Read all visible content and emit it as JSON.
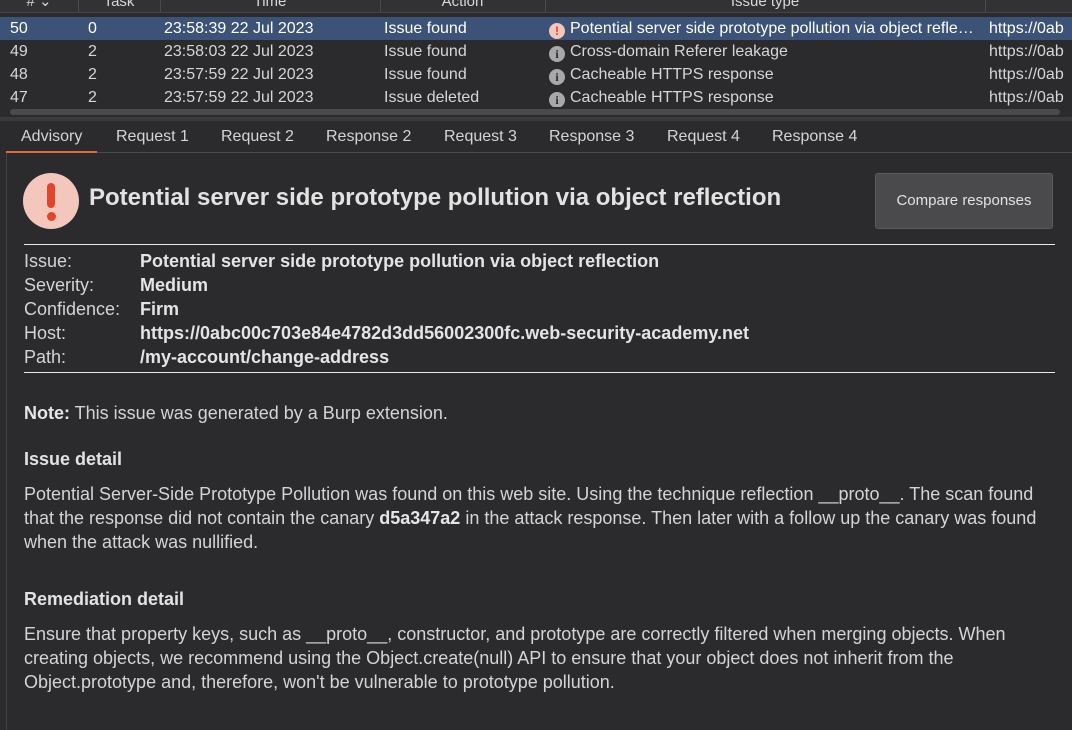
{
  "table": {
    "columns": [
      {
        "label": "# ⌄"
      },
      {
        "label": "Task"
      },
      {
        "label": "Time"
      },
      {
        "label": "Action"
      },
      {
        "label": "Issue type"
      }
    ],
    "rows": [
      {
        "num": "50",
        "task": "0",
        "time": "23:58:39 22 Jul 2023",
        "action": "Issue found",
        "issue": "Potential server side prototype pollution via object refle…",
        "host": "https://0ab",
        "severity": "high"
      },
      {
        "num": "49",
        "task": "2",
        "time": "23:58:03 22 Jul 2023",
        "action": "Issue found",
        "issue": "Cross-domain Referer leakage",
        "host": "https://0ab",
        "severity": "info"
      },
      {
        "num": "48",
        "task": "2",
        "time": "23:57:59 22 Jul 2023",
        "action": "Issue found",
        "issue": "Cacheable HTTPS response",
        "host": "https://0ab",
        "severity": "info"
      },
      {
        "num": "47",
        "task": "2",
        "time": "23:57:59 22 Jul 2023",
        "action": "Issue deleted",
        "issue": "Cacheable HTTPS response",
        "host": "https://0ab",
        "severity": "info"
      }
    ]
  },
  "tabs": [
    "Advisory",
    "Request 1",
    "Request 2",
    "Response 2",
    "Request 3",
    "Response 3",
    "Request 4",
    "Response 4"
  ],
  "advisory": {
    "title": "Potential server side prototype pollution via object reflection",
    "compare_label": "Compare responses",
    "fields": {
      "issue_label": "Issue:",
      "issue": "Potential server side prototype pollution via object reflection",
      "severity_label": "Severity:",
      "severity": "Medium",
      "confidence_label": "Confidence:",
      "confidence": "Firm",
      "host_label": "Host:",
      "host": "https://0abc00c703e84e4782d3dd56002300fc.web-security-academy.net",
      "path_label": "Path:",
      "path": "/my-account/change-address"
    },
    "note_label": "Note:",
    "note_text": " This issue was generated by a Burp extension.",
    "issue_detail_heading": "Issue detail",
    "issue_detail_1": "Potential Server-Side Prototype Pollution was found on this web site. Using the technique reflection __proto__. The scan found that the response did not contain the canary ",
    "issue_detail_canary": "d5a347a2",
    "issue_detail_2": " in the attack response. Then later with a follow up the canary was found when the attack was nullified.",
    "remediation_heading": "Remediation detail",
    "remediation_text": "Ensure that property keys, such as __proto__, constructor, and prototype are correctly filtered when merging objects. When creating objects, we recommend using the Object.create(null) API to ensure that your object does not inherit from the Object.prototype and, therefore, won't be vulnerable to prototype pollution."
  },
  "colors": {
    "selected_row": "#3c5276",
    "active_tab": "#e06c3c",
    "high_icon": "#e0452d",
    "background": "#2b2b2d"
  }
}
